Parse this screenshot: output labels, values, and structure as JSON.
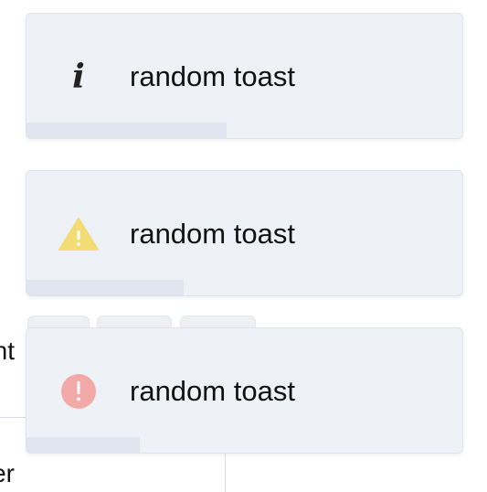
{
  "background": {
    "fragment_1": "nt",
    "fragment_2": "er"
  },
  "toasts": [
    {
      "type": "info",
      "icon": "info-icon",
      "message": "random toast",
      "progress": 0.46,
      "accent": "#222222"
    },
    {
      "type": "warning",
      "icon": "warning-icon",
      "message": "random toast",
      "progress": 0.36,
      "accent": "#f2dc74"
    },
    {
      "type": "error",
      "icon": "error-icon",
      "message": "random toast",
      "progress": 0.26,
      "accent": "#f2aaa8"
    }
  ]
}
